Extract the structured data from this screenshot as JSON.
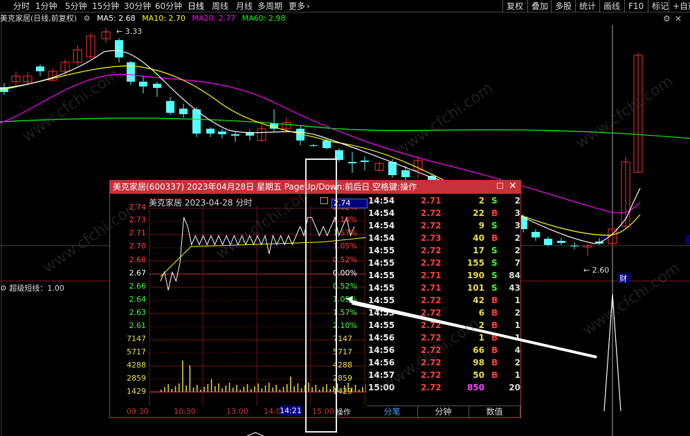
{
  "toolbar": {
    "periods": [
      "分时",
      "1分钟",
      "5分钟",
      "15分钟",
      "30分钟",
      "60分钟",
      "日线",
      "周线",
      "月线",
      "多周期",
      "更多"
    ],
    "active_period": "日线",
    "right_buttons": [
      "复权",
      "叠加",
      "多股",
      "统计",
      "画线",
      "F10",
      "标记",
      "+自选"
    ]
  },
  "main_chart": {
    "stock_label": "美克家居(日线,前复权)",
    "ma5": "MA5: 2.68",
    "ma10": "MA10: 2.70",
    "ma20": "MA20: 2.77",
    "ma60": "MA60: 2.98",
    "high_mark": "3.33",
    "low_mark": "2.60",
    "cai_label": "财",
    "indicator_label": "超级短线：1.00",
    "colors": {
      "up": "#ff3232",
      "down": "#54ffff",
      "ma5": "#ffffff",
      "ma10": "#ffff00",
      "ma20": "#ff00ff",
      "ma60": "#00ff00"
    }
  },
  "popup": {
    "title": "美克家居(600337) 2023年04月28日 星期五 PageUp/Down:前后日 空格键:操作",
    "mini_header": "美克家居  2023-04-28 分时",
    "current_price": "2.74",
    "price_labels": [
      {
        "text": "2.74",
        "color": "#ff4040"
      },
      {
        "text": "2.73",
        "color": "#ff4040"
      },
      {
        "text": "2.71",
        "color": "#ff4040"
      },
      {
        "text": "2.70",
        "color": "#ff4040"
      },
      {
        "text": "2.68",
        "color": "#ff4040"
      },
      {
        "text": "2.67",
        "color": "#ffffff"
      },
      {
        "text": "2.66",
        "color": "#40ff40"
      },
      {
        "text": "2.64",
        "color": "#40ff40"
      },
      {
        "text": "2.63",
        "color": "#40ff40"
      },
      {
        "text": "2.61",
        "color": "#40ff40"
      },
      {
        "text": "7147",
        "color": "#e8e040"
      },
      {
        "text": "5717",
        "color": "#e8e040"
      },
      {
        "text": "4288",
        "color": "#e8e040"
      },
      {
        "text": "2859",
        "color": "#e8e040"
      },
      {
        "text": "1429",
        "color": "#e8e040"
      }
    ],
    "pct_labels": [
      {
        "text": "2.62%",
        "color": "#ff4040"
      },
      {
        "text": "2.10%",
        "color": "#ff4040"
      },
      {
        "text": "1.57%",
        "color": "#ff4040"
      },
      {
        "text": "1.05%",
        "color": "#ff4040"
      },
      {
        "text": "0.52%",
        "color": "#ff4040"
      },
      {
        "text": "0.00%",
        "color": "#ffffff"
      },
      {
        "text": "0.52%",
        "color": "#40ff40"
      },
      {
        "text": "1.05%",
        "color": "#40ff40"
      },
      {
        "text": "1.57%",
        "color": "#40ff40"
      },
      {
        "text": "2.10%",
        "color": "#40ff40"
      },
      {
        "text": "7147",
        "color": "#e8e040"
      },
      {
        "text": "5717",
        "color": "#e8e040"
      },
      {
        "text": "4288",
        "color": "#e8e040"
      },
      {
        "text": "2859",
        "color": "#e8e040"
      },
      {
        "text": "1429",
        "color": "#e8e040"
      }
    ],
    "time_labels": [
      "09:30",
      "10:30",
      "13:00",
      "14:00",
      "15:00"
    ],
    "time_cursor": "14:21",
    "operate_label": "操作",
    "ticks": [
      {
        "time": "14:54",
        "price": "2.71",
        "vol": "2",
        "side": "S",
        "num": "2"
      },
      {
        "time": "14:54",
        "price": "2.72",
        "vol": "22",
        "side": "B",
        "num": "3"
      },
      {
        "time": "14:54",
        "price": "2.72",
        "vol": "9",
        "side": "S",
        "num": "3"
      },
      {
        "time": "14:54",
        "price": "2.73",
        "vol": "40",
        "side": "B",
        "num": "2"
      },
      {
        "time": "14:55",
        "price": "2.72",
        "vol": "17",
        "side": "S",
        "num": "2"
      },
      {
        "time": "14:55",
        "price": "2.72",
        "vol": "155",
        "side": "S",
        "num": "7"
      },
      {
        "time": "14:55",
        "price": "2.71",
        "vol": "190",
        "side": "S",
        "num": "84"
      },
      {
        "time": "14:55",
        "price": "2.71",
        "vol": "101",
        "side": "S",
        "num": "43"
      },
      {
        "time": "14:55",
        "price": "2.72",
        "vol": "42",
        "side": "B",
        "num": "1"
      },
      {
        "time": "14:55",
        "price": "2.72",
        "vol": "6",
        "side": "B",
        "num": "2"
      },
      {
        "time": "14:55",
        "price": "2.72",
        "vol": "2",
        "side": "B",
        "num": "1"
      },
      {
        "time": "14:56",
        "price": "2.72",
        "vol": "1",
        "side": "B",
        "num": "1"
      },
      {
        "time": "14:56",
        "price": "2.72",
        "vol": "66",
        "side": "B",
        "num": "4"
      },
      {
        "time": "14:56",
        "price": "2.72",
        "vol": "98",
        "side": "B",
        "num": "2"
      },
      {
        "time": "14:57",
        "price": "2.72",
        "vol": "50",
        "side": "B",
        "num": "1"
      },
      {
        "time": "15:00",
        "price": "2.72",
        "vol": "850",
        "side": "",
        "num": "20"
      }
    ],
    "tick_tabs": [
      "分笔",
      "分钟",
      "数值"
    ],
    "side_colors": {
      "B": "#ff4040",
      "S": "#40ff40"
    }
  },
  "watermark": "www.cfchi.com"
}
